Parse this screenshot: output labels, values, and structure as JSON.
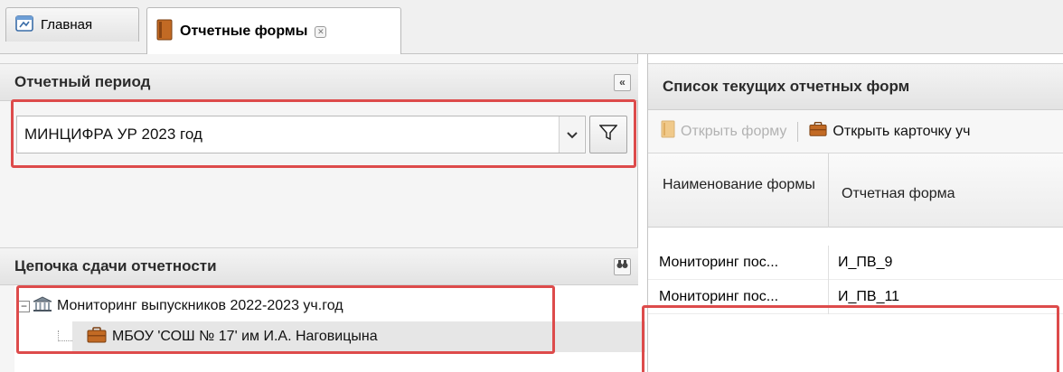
{
  "tabs": [
    {
      "label": "Главная",
      "icon": "home-window-icon",
      "active": false
    },
    {
      "label": "Отчетные формы",
      "icon": "book-icon",
      "active": true
    }
  ],
  "left": {
    "period": {
      "title": "Отчетный период",
      "collapse_glyph": "«",
      "selected_value": "МИНЦИФРА УР 2023 год"
    },
    "chain": {
      "title": "Цепочка сдачи отчетности",
      "search_glyph": "👁",
      "tree": [
        {
          "label": "Мониторинг выпускников 2022-2023 уч.год",
          "icon": "institution-icon",
          "expanded": true
        },
        {
          "label": "МБОУ 'СОШ № 17' им И.А. Наговицына",
          "icon": "briefcase-icon",
          "selected": true
        }
      ]
    }
  },
  "right": {
    "title": "Список текущих отчетных форм",
    "toolbar": {
      "open_form": "Открыть форму",
      "open_card": "Открыть карточку уч"
    },
    "grid": {
      "columns": [
        "Наименование формы",
        "Отчетная форма"
      ],
      "rows": [
        [
          "Мониторинг пос...",
          "И_ПВ_9"
        ],
        [
          "Мониторинг пос...",
          "И_ПВ_11"
        ]
      ]
    }
  },
  "colors": {
    "highlight": "#dd4b4b",
    "briefcase": "#b8651b",
    "header_bg": "#e8e8e8"
  }
}
